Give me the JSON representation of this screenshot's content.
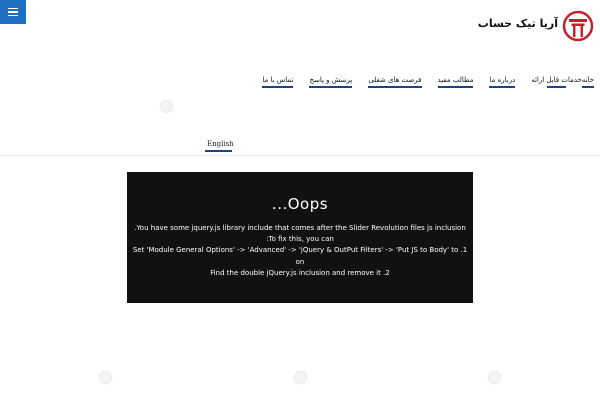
{
  "header": {
    "logo_text": "آریا تیک حساب",
    "menu_icon": "hamburger-icon"
  },
  "nav": {
    "items": [
      {
        "label": "خانه"
      },
      {
        "label": "خدمات قابل ارائه"
      },
      {
        "label": "درباره ما"
      },
      {
        "label": "مطالب مفید"
      },
      {
        "label": "فرصت های شغلی"
      },
      {
        "label": "پرسش و پاسخ"
      },
      {
        "label": "تماس با ما"
      }
    ]
  },
  "language": {
    "label": "English"
  },
  "error": {
    "title": "Oops...",
    "lines": [
      "You have some jquery.js library include that comes after the Slider Revolution files js inclusion.",
      "To fix this, you can:",
      "1. Set 'Module General Options' -> 'Advanced' -> 'jQuery & OutPut Filters' -> 'Put JS to Body' to",
      "on",
      "2. Find the double jQuery.js inclusion and remove it"
    ]
  },
  "colors": {
    "accent": "#1f6fc3",
    "nav_underline": "#1f3f8f",
    "logo_red": "#c8202a",
    "error_bg": "#111111"
  }
}
